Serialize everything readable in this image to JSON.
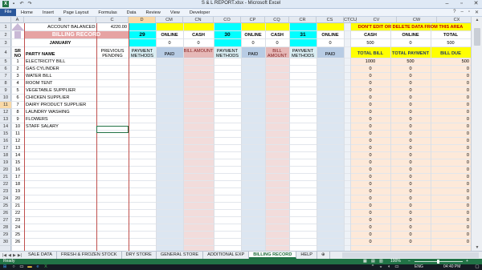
{
  "window": {
    "title": "S & L REPORT.xlsx - Microsoft Excel"
  },
  "ribbon": {
    "file_label": "File",
    "tabs": [
      "Home",
      "Insert",
      "Page Layout",
      "Formulas",
      "Data",
      "Review",
      "View",
      "Developer"
    ]
  },
  "columns": [
    {
      "key": "A",
      "label": "A"
    },
    {
      "key": "B",
      "label": "B"
    },
    {
      "key": "C",
      "label": "C"
    },
    {
      "key": "D",
      "label": "D",
      "selected": true
    },
    {
      "key": "CM",
      "label": "CM"
    },
    {
      "key": "CN",
      "label": "CN"
    },
    {
      "key": "CO",
      "label": "CO"
    },
    {
      "key": "CP",
      "label": "CP"
    },
    {
      "key": "CQ",
      "label": "CQ"
    },
    {
      "key": "CR",
      "label": "CR"
    },
    {
      "key": "CS",
      "label": "CS"
    },
    {
      "key": "CT",
      "label": "CT"
    },
    {
      "key": "CU",
      "label": "CU"
    },
    {
      "key": "CV",
      "label": "CV"
    },
    {
      "key": "CW",
      "label": "CW"
    },
    {
      "key": "CX",
      "label": "CX"
    }
  ],
  "selected_row": 11,
  "header": {
    "account_label": "ACCOUNT BALANCED:",
    "account_value": "4220.00",
    "billing_record": "BILLING RECORD",
    "month": "JANUARY",
    "sr_no": "SR NO",
    "party_name": "PARTY NAME",
    "previous_pending": "PREVIOUS PENDING"
  },
  "day_blocks": [
    {
      "day": "29",
      "online_value": "0",
      "cash_value": "0"
    },
    {
      "day": "30",
      "online_value": "0",
      "cash_value": "0"
    },
    {
      "day": "31",
      "online_value": "0",
      "cash_value": ""
    }
  ],
  "labels": {
    "online": "ONLINE",
    "cash": "CASH",
    "payment_methods": "PAYMENT METHODS",
    "paid": "PAID",
    "bill_amount": "BILL AMOUNT"
  },
  "summary": {
    "warning": "DON'T EDIT OR DELETE DATA FROM THIS AREA",
    "cash_label": "CASH",
    "online_label": "ONLINE",
    "total_label": "TOTAL",
    "cash_value": "500",
    "online_value": "0",
    "total_value": "500",
    "total_bill": "TOTAL BILL",
    "total_payment": "TOTAL PAYMENT",
    "bill_due": "BILL DUE"
  },
  "parties": [
    {
      "sr": "1",
      "name": "ELECTRICITY BILL",
      "total_bill": "1000",
      "total_payment": "500",
      "bill_due": "500"
    },
    {
      "sr": "2",
      "name": "GAS CYLINDER",
      "total_bill": "0",
      "total_payment": "0",
      "bill_due": "0"
    },
    {
      "sr": "3",
      "name": "WATER BILL",
      "total_bill": "0",
      "total_payment": "0",
      "bill_due": "0"
    },
    {
      "sr": "4",
      "name": "ROOM TENT",
      "total_bill": "0",
      "total_payment": "0",
      "bill_due": "0"
    },
    {
      "sr": "5",
      "name": "VEGETABLE SUPPLIER",
      "total_bill": "0",
      "total_payment": "0",
      "bill_due": "0"
    },
    {
      "sr": "6",
      "name": "CHICKEN SUPPLIER",
      "total_bill": "0",
      "total_payment": "0",
      "bill_due": "0"
    },
    {
      "sr": "7",
      "name": "DAIRY PRODUCT SUPPLIER",
      "total_bill": "0",
      "total_payment": "0",
      "bill_due": "0"
    },
    {
      "sr": "8",
      "name": "LAUNDRY WASHING",
      "total_bill": "0",
      "total_payment": "0",
      "bill_due": "0"
    },
    {
      "sr": "9",
      "name": "FLOWERS",
      "total_bill": "0",
      "total_payment": "0",
      "bill_due": "0"
    },
    {
      "sr": "10",
      "name": "STAFF SALARY",
      "total_bill": "0",
      "total_payment": "0",
      "bill_due": "0"
    },
    {
      "sr": "11",
      "name": "",
      "total_bill": "0",
      "total_payment": "0",
      "bill_due": "0"
    },
    {
      "sr": "12",
      "name": "",
      "total_bill": "0",
      "total_payment": "0",
      "bill_due": "0"
    },
    {
      "sr": "13",
      "name": "",
      "total_bill": "0",
      "total_payment": "0",
      "bill_due": "0"
    },
    {
      "sr": "14",
      "name": "",
      "total_bill": "0",
      "total_payment": "0",
      "bill_due": "0"
    },
    {
      "sr": "15",
      "name": "",
      "total_bill": "0",
      "total_payment": "0",
      "bill_due": "0"
    },
    {
      "sr": "16",
      "name": "",
      "total_bill": "0",
      "total_payment": "0",
      "bill_due": "0"
    },
    {
      "sr": "17",
      "name": "",
      "total_bill": "0",
      "total_payment": "0",
      "bill_due": "0"
    },
    {
      "sr": "18",
      "name": "",
      "total_bill": "0",
      "total_payment": "0",
      "bill_due": "0"
    },
    {
      "sr": "19",
      "name": "",
      "total_bill": "0",
      "total_payment": "0",
      "bill_due": "0"
    },
    {
      "sr": "20",
      "name": "",
      "total_bill": "0",
      "total_payment": "0",
      "bill_due": "0"
    },
    {
      "sr": "21",
      "name": "",
      "total_bill": "0",
      "total_payment": "0",
      "bill_due": "0"
    },
    {
      "sr": "22",
      "name": "",
      "total_bill": "0",
      "total_payment": "0",
      "bill_due": "0"
    },
    {
      "sr": "23",
      "name": "",
      "total_bill": "0",
      "total_payment": "0",
      "bill_due": "0"
    },
    {
      "sr": "24",
      "name": "",
      "total_bill": "0",
      "total_payment": "0",
      "bill_due": "0"
    },
    {
      "sr": "25",
      "name": "",
      "total_bill": "0",
      "total_payment": "0",
      "bill_due": "0"
    },
    {
      "sr": "26",
      "name": "",
      "total_bill": "0",
      "total_payment": "0",
      "bill_due": "0"
    }
  ],
  "sheet_tabs": [
    {
      "label": "SALE DATA",
      "active": false
    },
    {
      "label": "FRESH & FROZEN STOCK",
      "active": false
    },
    {
      "label": "DRY STORE",
      "active": false
    },
    {
      "label": "GENERAL STORE",
      "active": false
    },
    {
      "label": "ADDITIONAL EXP",
      "active": false
    },
    {
      "label": "BILLING RECORD",
      "active": true
    },
    {
      "label": "HELP",
      "active": false
    }
  ],
  "status": {
    "ready": "Ready",
    "zoom": "100%"
  },
  "taskbar": {
    "lang": "ENG",
    "time": "04:40 PM"
  },
  "colors": {
    "online_header": "#00ffff",
    "paid_blue": "#dce6f1",
    "bill_amount_pink": "#e6b8b7",
    "summary_yellow": "#ffff00",
    "summary_peach": "#fde9d9",
    "billing_record_red": "#e6a3a3",
    "excel_green": "#217346"
  }
}
